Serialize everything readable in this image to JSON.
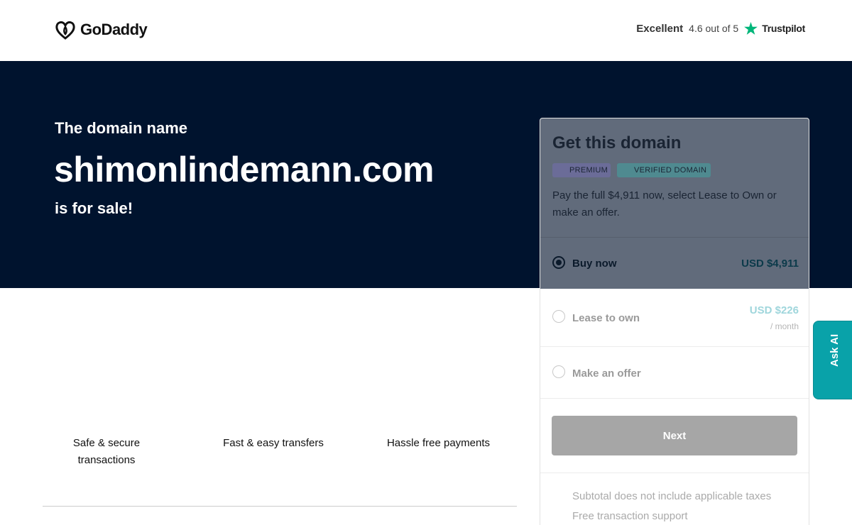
{
  "header": {
    "logo_text": "GoDaddy",
    "rating_word": "Excellent",
    "rating_score": "4.6 out of 5",
    "rating_brand": "Trustpilot",
    "star_color": "#00b67a"
  },
  "hero": {
    "pre": "The domain name",
    "domain": "shimonlindemann.com",
    "post": "is for sale!",
    "background": "#00132e"
  },
  "features": [
    "Safe & secure transactions",
    "Fast & easy transfers",
    "Hassle free payments"
  ],
  "card": {
    "title": "Get this domain",
    "badges": [
      "PREMIUM",
      "VERIFIED DOMAIN"
    ],
    "description": "Pay the full $4,911 now, select Lease to Own or make an offer.",
    "options": [
      {
        "label": "Buy now",
        "price": "USD $4,911",
        "selected": true
      },
      {
        "label": "Lease to own",
        "price": "USD $226",
        "period": "/ month",
        "selected": false
      },
      {
        "label": "Make an offer",
        "selected": false
      }
    ],
    "next_label": "Next",
    "notes": [
      "Subtotal does not include applicable taxes",
      "Free transaction support"
    ]
  },
  "ask_ai": "Ask AI"
}
